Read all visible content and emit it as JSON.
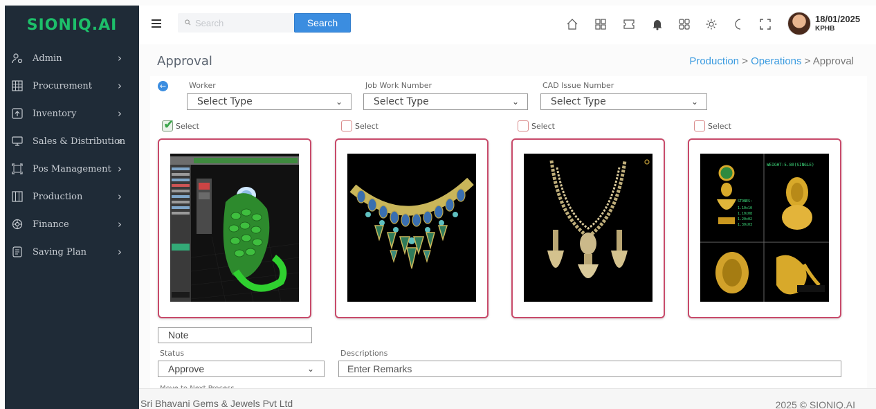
{
  "logo": {
    "text": "SIONIQ.AI"
  },
  "sidebar": {
    "items": [
      {
        "label": "Admin",
        "icon": "user-gear-icon"
      },
      {
        "label": "Procurement",
        "icon": "grid-icon"
      },
      {
        "label": "Inventory",
        "icon": "upload-box-icon"
      },
      {
        "label": "Sales & Distribution",
        "icon": "monitor-icon"
      },
      {
        "label": "Pos Management",
        "icon": "frame-icon"
      },
      {
        "label": "Production",
        "icon": "columns-icon"
      },
      {
        "label": "Finance",
        "icon": "gear-flower-icon"
      },
      {
        "label": "Saving Plan",
        "icon": "document-icon"
      }
    ]
  },
  "header": {
    "search_placeholder": "Search",
    "search_button": "Search",
    "user_date": "18/01/2025",
    "user_branch": "KPHB"
  },
  "page": {
    "title": "Approval",
    "breadcrumb": {
      "level1": "Production",
      "sep1": " > ",
      "level2": "Operations",
      "sep2": " > ",
      "current": "Approval"
    }
  },
  "filters": {
    "worker_label": "Worker",
    "worker_value": "Select Type",
    "job_label": "Job Work Number",
    "job_value": "Select Type",
    "cad_label": "CAD Issue Number",
    "cad_value": "Select Type"
  },
  "tiles": [
    {
      "select_label": "Select",
      "checked": true,
      "subject": "green-ring-cad"
    },
    {
      "select_label": "Select",
      "checked": false,
      "subject": "teal-necklace-cad"
    },
    {
      "select_label": "Select",
      "checked": false,
      "subject": "gold-necklace-cad"
    },
    {
      "select_label": "Select",
      "checked": false,
      "subject": "gold-earring-cad"
    }
  ],
  "form": {
    "note_value": "Note",
    "status_label": "Status",
    "status_value": "Approve",
    "descriptions_label": "Descriptions",
    "remarks_placeholder": "Enter Remarks",
    "partial_label": "Move to Next Process"
  },
  "footer": {
    "company": "Sri Bhavani Gems & Jewels Pvt Ltd",
    "copyright": "2025 © SIONIQ.AI"
  },
  "colors": {
    "sidebar_bg": "#1f2b37",
    "brand_green": "#1dbf6a",
    "primary_blue": "#3b8de0",
    "tile_border": "#c84a6a"
  }
}
